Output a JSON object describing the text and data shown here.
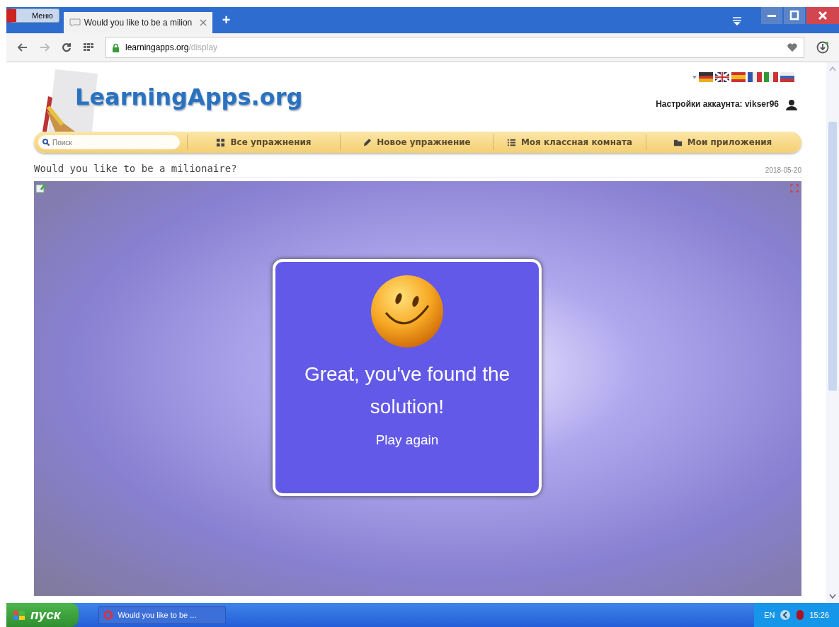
{
  "browser": {
    "menu_label": "Меню",
    "tabs": [
      {
        "title": "Would you like to be a milion",
        "selected": true
      }
    ],
    "new_tab": "+",
    "url_host": "learningapps.org",
    "url_path": "/display"
  },
  "site": {
    "logo": "LearningApps.org",
    "account": "Настройки аккаунта: vikser96",
    "search": {
      "placeholder": "Поиск"
    },
    "nav": [
      {
        "label": "Все упражнения",
        "kind": "grid"
      },
      {
        "label": "Новое упражнение",
        "kind": "pencil"
      },
      {
        "label": "Моя классная комната",
        "kind": "list"
      },
      {
        "label": "Мои приложения",
        "kind": "folder"
      }
    ],
    "title": "Would you like to be a milionaire?",
    "date": "2018-05-20"
  },
  "game": {
    "message": "Great, you've found the solution!",
    "action": "Play again"
  },
  "taskbar": {
    "start": "пуск",
    "tasks": [
      {
        "title": "Would you like to be ..."
      }
    ],
    "lang": "EN",
    "time": "15:26"
  }
}
